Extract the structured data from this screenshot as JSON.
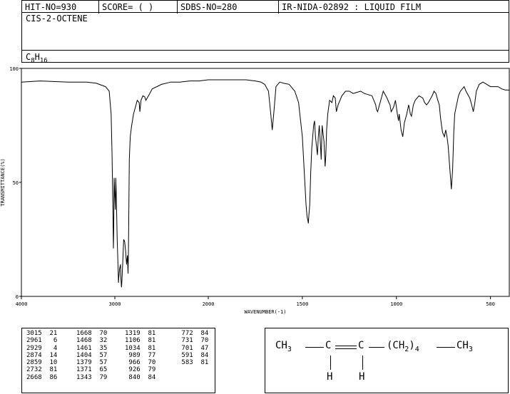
{
  "header": {
    "hit_no": "HIT-NO=930",
    "score": "SCORE=  (   )",
    "sdbs_no": "SDBS-NO=280",
    "ir_nida": "IR-NIDA-02892 : LIQUID FILM"
  },
  "compound": {
    "name": "CIS-2-OCTENE",
    "formula_c": "C",
    "formula_c_sub": "8",
    "formula_h": "H",
    "formula_h_sub": "16"
  },
  "chart_data": {
    "type": "line",
    "xlabel": "WAVENUMBER(-1)",
    "ylabel": "TRANSMITTANCE(%)",
    "xlim": [
      4000,
      400
    ],
    "ylim": [
      0,
      100
    ],
    "x_ticks": [
      4000,
      3000,
      2000,
      1500,
      1000,
      500
    ],
    "y_ticks": [
      0,
      50,
      100
    ],
    "series": [
      {
        "x": [
          4000,
          3800,
          3500,
          3300,
          3200,
          3100,
          3060,
          3040,
          3030,
          3020,
          3015,
          3012,
          3008,
          2995,
          2990,
          2985,
          2975,
          2965,
          2961,
          2958,
          2950,
          2940,
          2935,
          2929,
          2925,
          2915,
          2905,
          2895,
          2885,
          2880,
          2874,
          2870,
          2865,
          2859,
          2855,
          2845,
          2835,
          2820,
          2800,
          2780,
          2760,
          2740,
          2732,
          2720,
          2700,
          2680,
          2668,
          2640,
          2600,
          2500,
          2400,
          2300,
          2200,
          2100,
          2000,
          1900,
          1800,
          1750,
          1720,
          1700,
          1680,
          1668,
          1660,
          1650,
          1640,
          1620,
          1600,
          1570,
          1540,
          1520,
          1500,
          1490,
          1480,
          1475,
          1470,
          1468,
          1465,
          1461,
          1455,
          1450,
          1440,
          1435,
          1430,
          1420,
          1415,
          1410,
          1404,
          1400,
          1395,
          1385,
          1379,
          1375,
          1371,
          1365,
          1355,
          1343,
          1335,
          1325,
          1319,
          1310,
          1290,
          1270,
          1250,
          1230,
          1210,
          1190,
          1170,
          1150,
          1130,
          1120,
          1110,
          1106,
          1100,
          1090,
          1070,
          1050,
          1040,
          1034,
          1028,
          1015,
          1005,
          995,
          989,
          985,
          975,
          966,
          958,
          945,
          935,
          926,
          920,
          910,
          900,
          880,
          860,
          850,
          840,
          830,
          810,
          800,
          790,
          780,
          772,
          765,
          755,
          745,
          738,
          731,
          725,
          715,
          708,
          701,
          695,
          690,
          680,
          670,
          660,
          650,
          640,
          630,
          610,
          600,
          591,
          583,
          575,
          560,
          540,
          520,
          500,
          480,
          460,
          440,
          420,
          400
        ],
        "y": [
          94,
          94.5,
          94,
          94,
          93.5,
          92,
          90,
          80,
          62,
          35,
          21,
          28,
          52,
          38,
          52,
          45,
          25,
          12,
          6,
          8,
          12,
          14,
          8,
          4,
          6,
          15,
          25,
          24,
          20,
          17,
          14,
          16,
          18,
          10,
          18,
          60,
          70,
          75,
          80,
          83,
          86,
          85,
          81,
          86,
          88,
          87.5,
          86,
          88,
          91,
          93,
          94,
          94,
          94.5,
          94.5,
          95,
          95,
          95,
          94.5,
          94,
          93,
          90,
          80,
          73,
          82,
          92,
          94,
          93.5,
          93,
          90,
          85,
          70,
          55,
          40,
          35,
          33,
          32,
          36,
          40,
          55,
          65,
          75,
          77,
          70,
          62,
          70,
          75,
          67,
          60,
          75,
          68,
          57,
          62,
          73,
          80,
          86,
          85,
          88,
          87,
          81,
          84,
          88,
          90,
          90,
          89,
          89.5,
          90,
          89,
          88.5,
          88,
          86,
          84,
          82,
          81,
          84,
          90,
          87,
          85,
          84,
          81,
          83,
          86,
          80,
          77,
          80,
          73,
          70,
          76,
          80,
          84,
          80,
          79,
          84,
          86,
          88,
          87,
          85,
          84,
          85,
          88,
          90,
          89,
          86,
          84,
          78,
          72,
          70,
          73,
          70,
          66,
          55,
          47,
          56,
          72,
          80,
          84,
          88,
          90,
          91,
          92,
          90,
          87,
          84,
          81,
          85,
          90,
          93,
          94,
          93,
          92,
          92,
          92,
          91,
          90.5,
          90.5
        ]
      }
    ]
  },
  "peak_table": {
    "columns": [
      [
        [
          "3015",
          "21"
        ],
        [
          "2961",
          "6"
        ],
        [
          "2929",
          "4"
        ],
        [
          "2874",
          "14"
        ],
        [
          "2859",
          "10"
        ],
        [
          "2732",
          "81"
        ],
        [
          "2668",
          "86"
        ]
      ],
      [
        [
          "1668",
          "70"
        ],
        [
          "1468",
          "32"
        ],
        [
          "1461",
          "35"
        ],
        [
          "1404",
          "57"
        ],
        [
          "1379",
          "57"
        ],
        [
          "1371",
          "65"
        ],
        [
          "1343",
          "79"
        ]
      ],
      [
        [
          "1319",
          "81"
        ],
        [
          "1106",
          "81"
        ],
        [
          "1034",
          "81"
        ],
        [
          "989",
          "77"
        ],
        [
          "966",
          "70"
        ],
        [
          "926",
          "79"
        ],
        [
          "840",
          "84"
        ]
      ],
      [
        [
          "772",
          "84"
        ],
        [
          "731",
          "70"
        ],
        [
          "701",
          "47"
        ],
        [
          "591",
          "84"
        ],
        [
          "583",
          "81"
        ]
      ]
    ]
  },
  "structure": {
    "ch3": "CH",
    "three": "3",
    "c": "C",
    "ch2": "(CH",
    "two": "2",
    "close": ")",
    "four": "4",
    "h": "H"
  }
}
